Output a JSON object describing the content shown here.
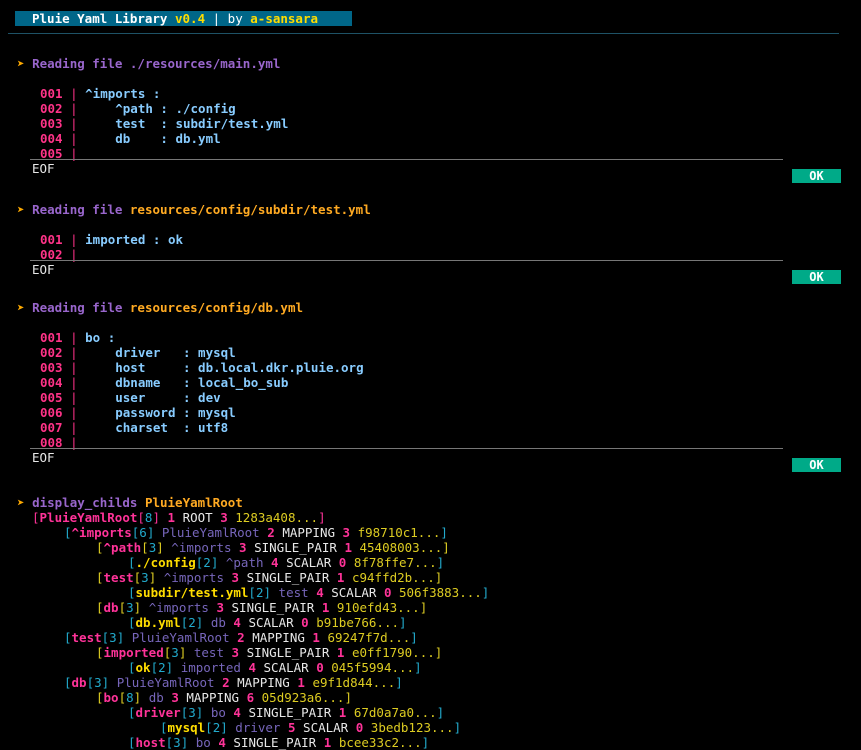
{
  "banner": {
    "title": "Pluie Yaml Library ",
    "version": "v0.4",
    "sep": " | by ",
    "author": "a-sansara"
  },
  "arrow": "➤",
  "files": [
    {
      "label": "Reading file",
      "path": "./resources/main.yml",
      "lines": [
        {
          "n": "001",
          "text": "^imports :"
        },
        {
          "n": "002",
          "text": "    ^path : ./config"
        },
        {
          "n": "003",
          "text": "    test  : subdir/test.yml"
        },
        {
          "n": "004",
          "text": "    db    : db.yml"
        },
        {
          "n": "005",
          "text": ""
        }
      ],
      "eof": "EOF",
      "status": "OK"
    },
    {
      "label": "Reading file",
      "path": "resources/config/subdir/test.yml",
      "lines": [
        {
          "n": "001",
          "text": "imported : ok"
        },
        {
          "n": "002",
          "text": ""
        }
      ],
      "eof": "EOF",
      "status": "OK"
    },
    {
      "label": "Reading file",
      "path": "resources/config/db.yml",
      "lines": [
        {
          "n": "001",
          "text": "bo :"
        },
        {
          "n": "002",
          "text": "    driver   : mysql"
        },
        {
          "n": "003",
          "text": "    host     : db.local.dkr.pluie.org"
        },
        {
          "n": "004",
          "text": "    dbname   : local_bo_sub"
        },
        {
          "n": "005",
          "text": "    user     : dev"
        },
        {
          "n": "006",
          "text": "    password : mysql"
        },
        {
          "n": "007",
          "text": "    charset  : utf8"
        },
        {
          "n": "008",
          "text": ""
        }
      ],
      "eof": "EOF",
      "status": "OK"
    }
  ],
  "display": {
    "cmd": "display_childs",
    "root": "PluieYamlRoot"
  },
  "tree": [
    {
      "indent": 0,
      "color": "m",
      "name": "PluieYamlRoot",
      "count": "8",
      "parent": "",
      "type": "ROOT",
      "depth": "3",
      "hash": "1283a408..."
    },
    {
      "indent": 1,
      "color": "m",
      "name": "^imports",
      "count": "6",
      "parent": "PluieYamlRoot",
      "type": "MAPPING",
      "depth": "3",
      "hash": "f98710c1..."
    },
    {
      "indent": 2,
      "color": "m",
      "name": "^path",
      "count": "3",
      "parent": "^imports",
      "type": "SINGLE_PAIR",
      "depth": "1",
      "hash": "45408003..."
    },
    {
      "indent": 3,
      "color": "y",
      "name": "./config",
      "count": "2",
      "parent": "^path",
      "type": "SCALAR",
      "depth": "0",
      "hash": "8f78ffe7..."
    },
    {
      "indent": 2,
      "color": "m",
      "name": "test",
      "count": "3",
      "parent": "^imports",
      "type": "SINGLE_PAIR",
      "depth": "1",
      "hash": "c94ffd2b..."
    },
    {
      "indent": 3,
      "color": "y",
      "name": "subdir/test.yml",
      "count": "2",
      "parent": "test",
      "type": "SCALAR",
      "depth": "0",
      "hash": "506f3883..."
    },
    {
      "indent": 2,
      "color": "m",
      "name": "db",
      "count": "3",
      "parent": "^imports",
      "type": "SINGLE_PAIR",
      "depth": "1",
      "hash": "910efd43..."
    },
    {
      "indent": 3,
      "color": "y",
      "name": "db.yml",
      "count": "2",
      "parent": "db",
      "type": "SCALAR",
      "depth": "0",
      "hash": "b91be766..."
    },
    {
      "indent": 1,
      "color": "m",
      "name": "test",
      "count": "3",
      "parent": "PluieYamlRoot",
      "type": "MAPPING",
      "depth": "1",
      "hash": "69247f7d..."
    },
    {
      "indent": 2,
      "color": "m",
      "name": "imported",
      "count": "3",
      "parent": "test",
      "type": "SINGLE_PAIR",
      "depth": "1",
      "hash": "e0ff1790..."
    },
    {
      "indent": 3,
      "color": "y",
      "name": "ok",
      "count": "2",
      "parent": "imported",
      "type": "SCALAR",
      "depth": "0",
      "hash": "045f5994..."
    },
    {
      "indent": 1,
      "color": "m",
      "name": "db",
      "count": "3",
      "parent": "PluieYamlRoot",
      "type": "MAPPING",
      "depth": "1",
      "hash": "e9f1d844..."
    },
    {
      "indent": 2,
      "color": "m",
      "name": "bo",
      "count": "8",
      "parent": "db",
      "type": "MAPPING",
      "depth": "6",
      "hash": "05d923a6..."
    },
    {
      "indent": 3,
      "color": "m",
      "name": "driver",
      "count": "3",
      "parent": "bo",
      "type": "SINGLE_PAIR",
      "depth": "1",
      "hash": "67d0a7a0..."
    },
    {
      "indent": 4,
      "color": "y",
      "name": "mysql",
      "count": "2",
      "parent": "driver",
      "type": "SCALAR",
      "depth": "0",
      "hash": "3bedb123..."
    },
    {
      "indent": 3,
      "color": "m",
      "name": "host",
      "count": "3",
      "parent": "bo",
      "type": "SINGLE_PAIR",
      "depth": "1",
      "hash": "bcee33c2..."
    }
  ]
}
